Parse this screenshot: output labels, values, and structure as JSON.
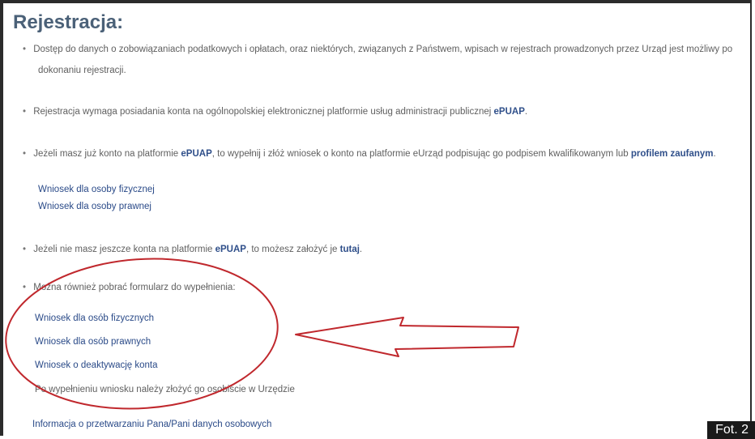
{
  "page": {
    "title": "Rejestracja:",
    "bullet1": "Dostęp do danych o zobowiązaniach podatkowych i opłatach, oraz niektórych, związanych z Państwem, wpisach w rejestrach prowadzonych przez Urząd jest możliwy po",
    "bullet1_cont": "dokonaniu rejestracji.",
    "bullet2_pre": "Rejestracja wymaga posiadania konta na ogólnopolskiej elektronicznej platformie usług administracji publicznej",
    "bullet2_strong": "ePUAP",
    "bullet2_post": ".",
    "bullet3_pre": "Jeżeli masz już konto na platformie",
    "bullet3_strong1": "ePUAP",
    "bullet3_mid": ", to wypełnij i złóż wniosek o konto na platformie eUrząd podpisując go podpisem kwalifikowanym lub",
    "bullet3_link": "profilem zaufanym",
    "bullet3_post": ".",
    "link_osoba_fizyczna": "Wniosek dla osoby fizycznej",
    "link_osoba_prawna": "Wniosek dla osoby prawnej",
    "bullet4_pre": "Jeżeli nie masz jeszcze konta na platformie",
    "bullet4_strong": "ePUAP",
    "bullet4_mid": ", to możesz założyć je",
    "bullet4_link": "tutaj",
    "bullet4_post": ".",
    "bullet5": "Można również pobrać formularz do wypełnienia:",
    "link_osob_fizycznych": "Wniosek dla osób fizycznych",
    "link_osob_prawnych": "Wniosek dla osób prawnych",
    "link_deaktywacja": "Wniosek o deaktywację konta",
    "note_after": "Po wypełnieniu wniosku należy złożyć go osobiście w Urzędzie",
    "link_rodo": "Informacja o przetwarzaniu Pana/Pani danych osobowych",
    "photo_label": "Fot. 2"
  },
  "colors": {
    "title": "#4b6178",
    "link": "#2a4a88",
    "annotation": "#c0282d"
  }
}
